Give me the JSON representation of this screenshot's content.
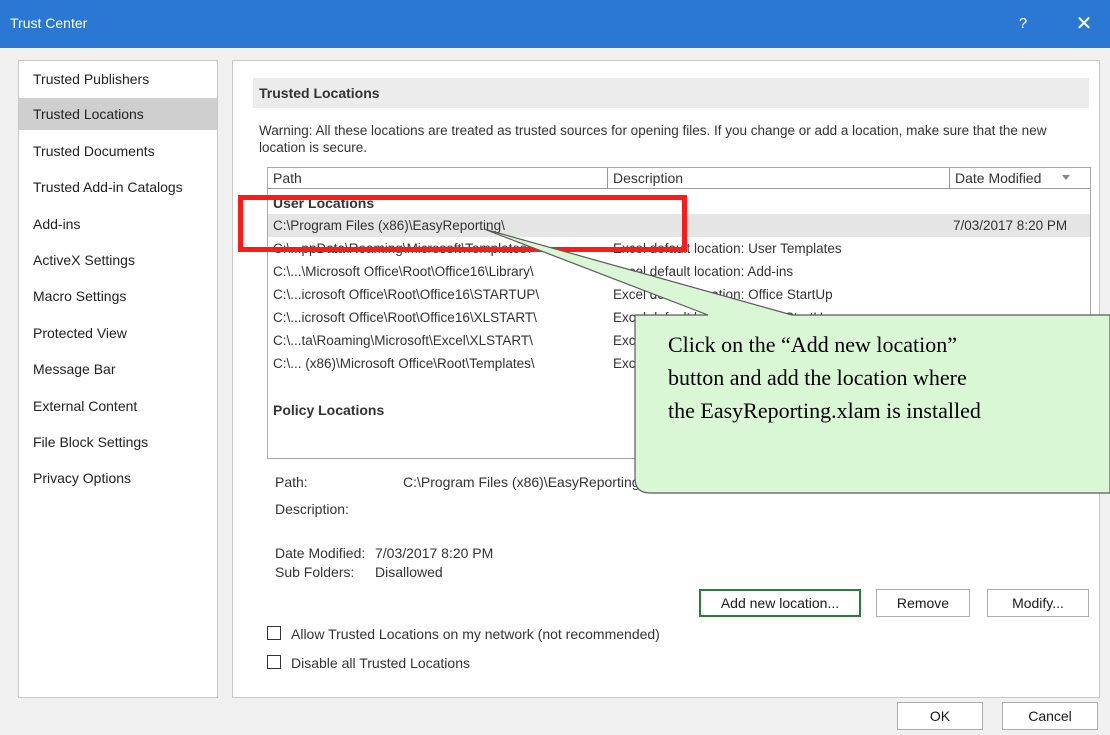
{
  "window": {
    "title": "Trust Center",
    "help": "?",
    "close": "✕"
  },
  "sidebar": {
    "items": [
      {
        "label": "Trusted Publishers"
      },
      {
        "label": "Trusted Locations"
      },
      {
        "label": "Trusted Documents"
      },
      {
        "label": "Trusted Add-in Catalogs"
      },
      {
        "label": "Add-ins"
      },
      {
        "label": "ActiveX Settings"
      },
      {
        "label": "Macro Settings"
      },
      {
        "label": "Protected View"
      },
      {
        "label": "Message Bar"
      },
      {
        "label": "External Content"
      },
      {
        "label": "File Block Settings"
      },
      {
        "label": "Privacy Options"
      }
    ],
    "selected": "Trusted Locations"
  },
  "main": {
    "section_title": "Trusted Locations",
    "warning": "Warning: All these locations are treated as trusted sources for opening files.  If you change or add a location, make sure that the new location is secure.",
    "columns": {
      "path": "Path",
      "description": "Description",
      "date": "Date Modified",
      "sort_icon": "sort-down-icon"
    },
    "user_locations_label": "User Locations",
    "rows": [
      {
        "path": "C:\\Program Files (x86)\\EasyReporting\\",
        "description": "",
        "date": "7/03/2017 8:20 PM"
      },
      {
        "path": "C:\\...ppData\\Roaming\\Microsoft\\Templates\\",
        "description": "Excel default location: User Templates",
        "date": ""
      },
      {
        "path": "C:\\...\\Microsoft Office\\Root\\Office16\\Library\\",
        "description": "Excel default location: Add-ins",
        "date": ""
      },
      {
        "path": "C:\\...icrosoft Office\\Root\\Office16\\STARTUP\\",
        "description": "Excel default location: Office StartUp",
        "date": ""
      },
      {
        "path": "C:\\...icrosoft Office\\Root\\Office16\\XLSTART\\",
        "description": "Excel default location: Excel StartUp",
        "date": ""
      },
      {
        "path": "C:\\...ta\\Roaming\\Microsoft\\Excel\\XLSTART\\",
        "description": "Excel default location: User StartUp",
        "date": ""
      },
      {
        "path": "C:\\... (x86)\\Microsoft Office\\Root\\Templates\\",
        "description": "Excel default location: Application Templates",
        "date": ""
      }
    ],
    "policy_locations_label": "Policy Locations",
    "details": {
      "path_label": "Path:",
      "path_value": "C:\\Program Files (x86)\\EasyReporting\\",
      "description_label": "Description:",
      "description_value": "",
      "date_label": "Date Modified:",
      "date_value": "7/03/2017 8:20 PM",
      "subfolders_label": "Sub Folders:",
      "subfolders_value": "Disallowed"
    },
    "buttons": {
      "add": "Add new location...",
      "remove": "Remove",
      "modify": "Modify..."
    },
    "checkboxes": [
      {
        "label": "Allow Trusted Locations on my network (not recommended)",
        "checked": false
      },
      {
        "label": "Disable all Trusted Locations",
        "checked": false
      }
    ]
  },
  "footer": {
    "ok": "OK",
    "cancel": "Cancel"
  },
  "annotation": {
    "callout_lines": [
      "Click on the “Add new location”",
      "button and add the location where",
      "the EasyReporting.xlam is installed"
    ],
    "callout_fill": "#d9f7d4",
    "callout_stroke": "#5a5a5a",
    "highlight_color": "#ff1a1a"
  }
}
